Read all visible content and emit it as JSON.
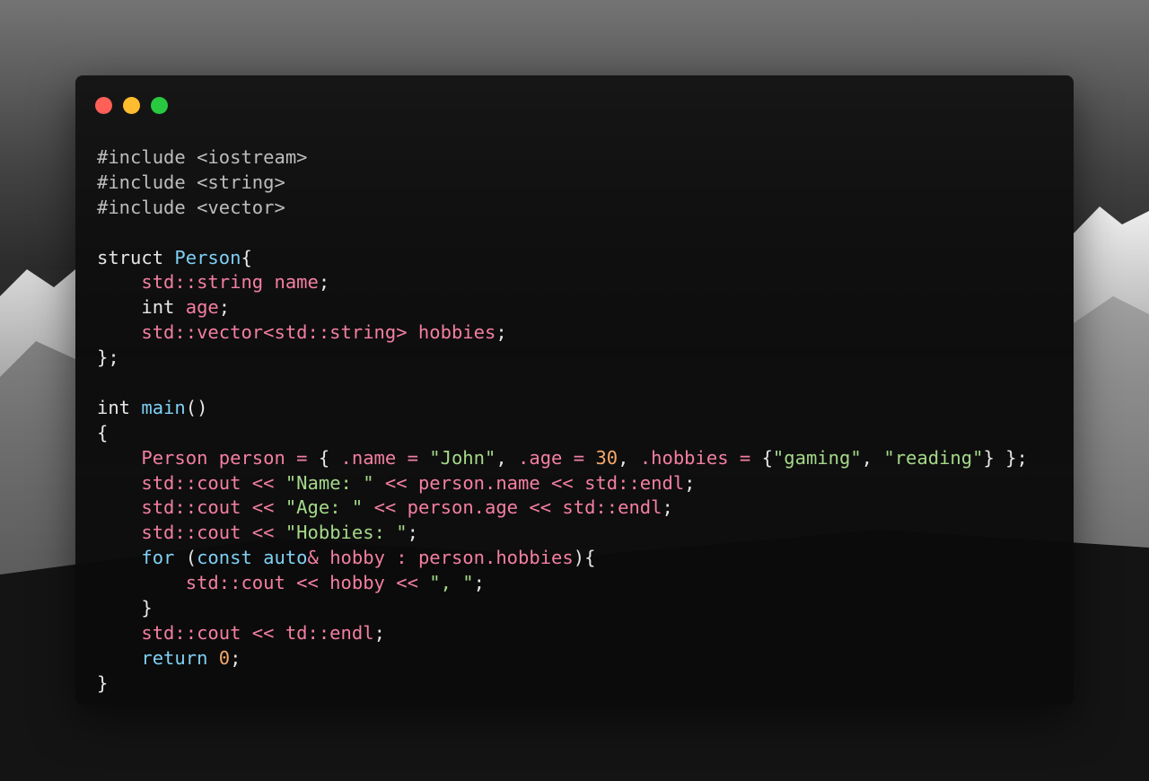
{
  "colors": {
    "close": "#fe5f57",
    "minimize": "#febc2e",
    "maximize": "#28c840",
    "preprocessor": "#bdbdbd",
    "keyword": "#7fd0f5",
    "type": "#f47fa2",
    "string": "#a6d98a",
    "number": "#f7a86a",
    "plain": "#e6e6e6",
    "operator": "#f47fa2"
  },
  "window": {
    "buttons": [
      {
        "name": "close-button",
        "color": "#fe5f57"
      },
      {
        "name": "minimize-button",
        "color": "#febc2e"
      },
      {
        "name": "maximize-button",
        "color": "#28c840"
      }
    ]
  },
  "code": {
    "language": "cpp",
    "lines": [
      [
        {
          "t": "#include <iostream>",
          "c": "preprocessor"
        }
      ],
      [
        {
          "t": "#include <string>",
          "c": "preprocessor"
        }
      ],
      [
        {
          "t": "#include <vector>",
          "c": "preprocessor"
        }
      ],
      [],
      [
        {
          "t": "struct ",
          "c": "plain"
        },
        {
          "t": "Person",
          "c": "keyword"
        },
        {
          "t": "{",
          "c": "plain"
        }
      ],
      [
        {
          "t": "    std::string name",
          "c": "type"
        },
        {
          "t": ";",
          "c": "plain"
        }
      ],
      [
        {
          "t": "    int ",
          "c": "plain"
        },
        {
          "t": "age",
          "c": "type"
        },
        {
          "t": ";",
          "c": "plain"
        }
      ],
      [
        {
          "t": "    std::vector<std::string> hobbies",
          "c": "type"
        },
        {
          "t": ";",
          "c": "plain"
        }
      ],
      [
        {
          "t": "};",
          "c": "plain"
        }
      ],
      [],
      [
        {
          "t": "int ",
          "c": "plain"
        },
        {
          "t": "main",
          "c": "keyword"
        },
        {
          "t": "()",
          "c": "plain"
        }
      ],
      [
        {
          "t": "{",
          "c": "plain"
        }
      ],
      [
        {
          "t": "    Person person = ",
          "c": "type"
        },
        {
          "t": "{ ",
          "c": "plain"
        },
        {
          "t": ".name = ",
          "c": "type"
        },
        {
          "t": "\"John\"",
          "c": "string"
        },
        {
          "t": ", ",
          "c": "plain"
        },
        {
          "t": ".age = ",
          "c": "type"
        },
        {
          "t": "30",
          "c": "number"
        },
        {
          "t": ", ",
          "c": "plain"
        },
        {
          "t": ".hobbies = ",
          "c": "type"
        },
        {
          "t": "{",
          "c": "plain"
        },
        {
          "t": "\"gaming\"",
          "c": "string"
        },
        {
          "t": ", ",
          "c": "plain"
        },
        {
          "t": "\"reading\"",
          "c": "string"
        },
        {
          "t": "} };",
          "c": "plain"
        }
      ],
      [
        {
          "t": "    std::cout << ",
          "c": "type"
        },
        {
          "t": "\"Name: \"",
          "c": "string"
        },
        {
          "t": " << person.name << std::endl",
          "c": "type"
        },
        {
          "t": ";",
          "c": "plain"
        }
      ],
      [
        {
          "t": "    std::cout << ",
          "c": "type"
        },
        {
          "t": "\"Age: \"",
          "c": "string"
        },
        {
          "t": " << person.age << std::endl",
          "c": "type"
        },
        {
          "t": ";",
          "c": "plain"
        }
      ],
      [
        {
          "t": "    std::cout << ",
          "c": "type"
        },
        {
          "t": "\"Hobbies: \"",
          "c": "string"
        },
        {
          "t": ";",
          "c": "plain"
        }
      ],
      [
        {
          "t": "    ",
          "c": "plain"
        },
        {
          "t": "for ",
          "c": "keyword"
        },
        {
          "t": "(",
          "c": "plain"
        },
        {
          "t": "const auto",
          "c": "keyword"
        },
        {
          "t": "& ",
          "c": "type"
        },
        {
          "t": "hobby : person.hobbies",
          "c": "type"
        },
        {
          "t": "){",
          "c": "plain"
        }
      ],
      [
        {
          "t": "        std::cout << hobby << ",
          "c": "type"
        },
        {
          "t": "\", \"",
          "c": "string"
        },
        {
          "t": ";",
          "c": "plain"
        }
      ],
      [
        {
          "t": "    }",
          "c": "plain"
        }
      ],
      [
        {
          "t": "    std::cout << td::endl",
          "c": "type"
        },
        {
          "t": ";",
          "c": "plain"
        }
      ],
      [
        {
          "t": "    ",
          "c": "plain"
        },
        {
          "t": "return ",
          "c": "keyword"
        },
        {
          "t": "0",
          "c": "number"
        },
        {
          "t": ";",
          "c": "plain"
        }
      ],
      [
        {
          "t": "}",
          "c": "plain"
        }
      ]
    ]
  }
}
